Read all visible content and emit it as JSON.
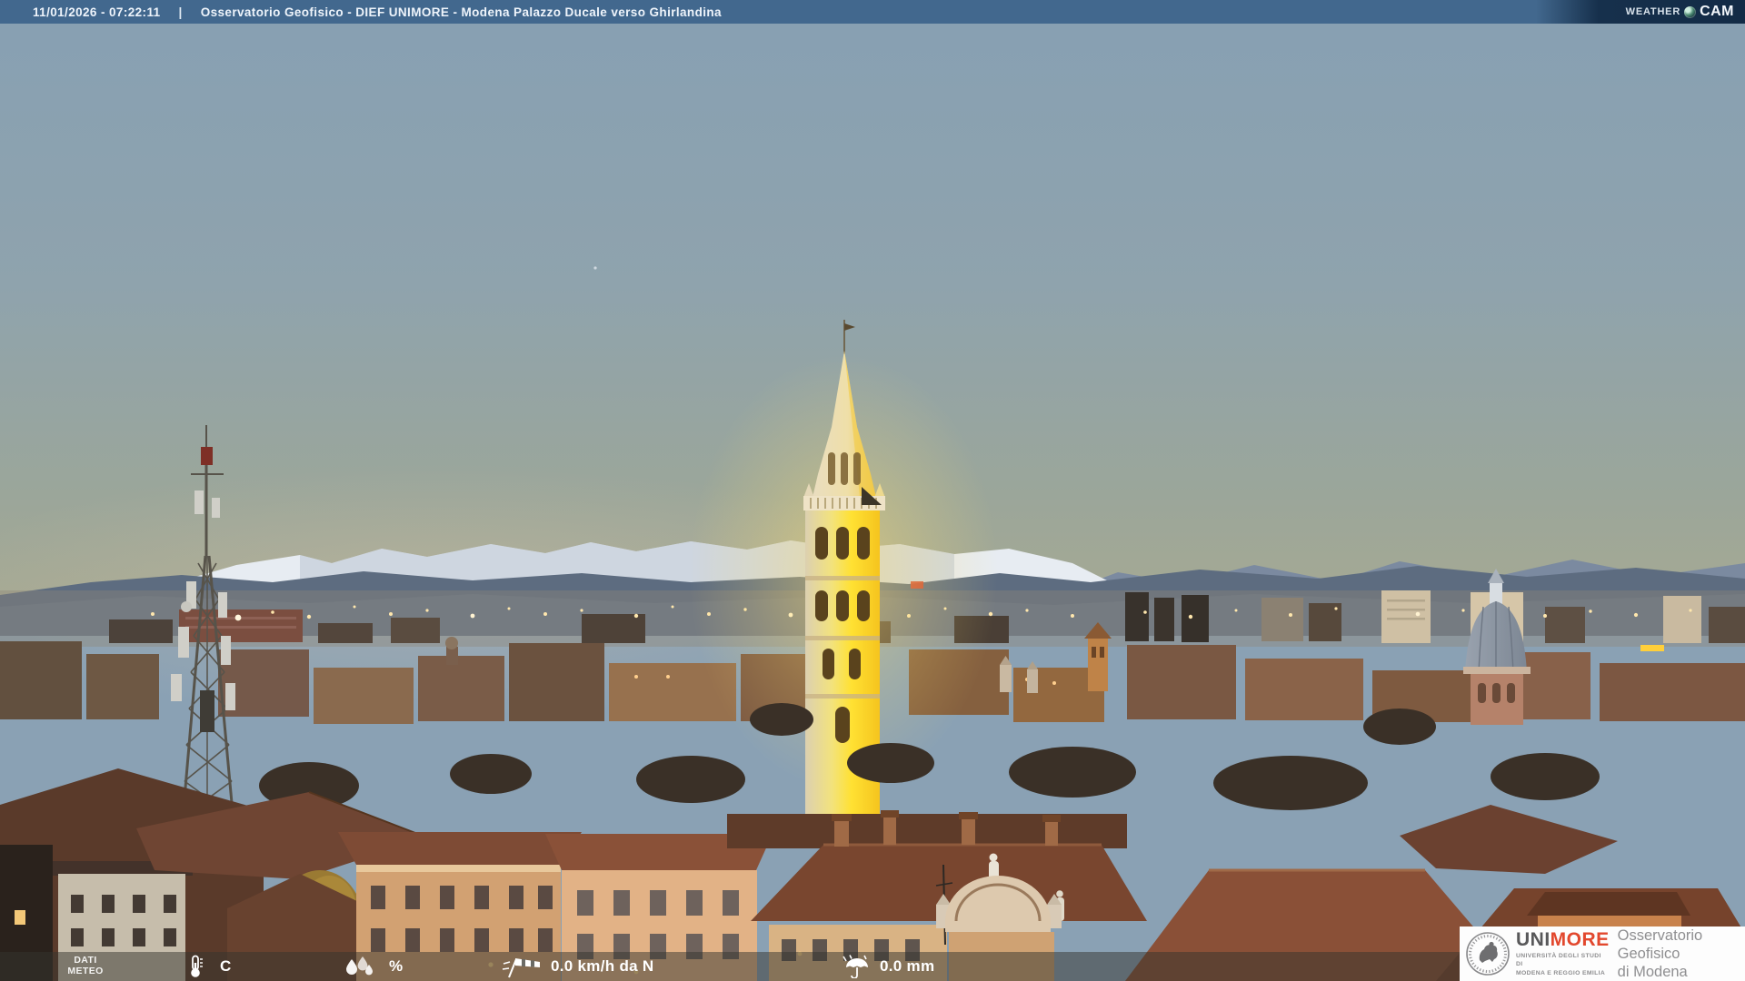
{
  "header": {
    "datetime": "11/01/2026 - 07:22:11",
    "separator": "|",
    "title": "Osservatorio Geofisico - DIEF UNIMORE - Modena Palazzo Ducale verso Ghirlandina",
    "weathercam": {
      "word1": "WEATHER",
      "word2": "CAM",
      "icon": "camera-lens-icon"
    }
  },
  "footer": {
    "dati": {
      "line1": "DATI",
      "line2": "METEO"
    },
    "readings": [
      {
        "id": "temperature",
        "icon": "thermometer-icon",
        "value": "",
        "unit": "C"
      },
      {
        "id": "humidity",
        "icon": "humidity-drops-icon",
        "value": "",
        "unit": "%"
      },
      {
        "id": "wind",
        "icon": "windsock-icon",
        "value": "0.0 km/h da N",
        "unit": ""
      },
      {
        "id": "rain",
        "icon": "umbrella-rain-icon",
        "value": "0.0 mm",
        "unit": ""
      }
    ]
  },
  "branding": {
    "seal_icon": "unimore-seal-icon",
    "acronym_part1": "UNI",
    "acronym_part2": "MORE",
    "university_line1": "UNIVERSITÀ DEGLI STUDI DI",
    "university_line2": "MODENA E REGGIO EMILIA",
    "observatory_line1": "Osservatorio Geofisico",
    "observatory_line2": "di Modena"
  },
  "scene": {
    "subject": "Modena skyline at dawn with illuminated Ghirlandina tower, Apennine mountains on horizon, telecom mast on left, church dome on right",
    "palette": {
      "header_bar": "#42688e",
      "header_logo_bg": "#16304c",
      "sky_top": "#87a0b3",
      "sky_horizon": "#a9aa91",
      "snow_peaks": "#e7ecf2",
      "hills": "#5d6c80",
      "tower_glow": "#ffd52e",
      "roof_terracotta": "#8a5037",
      "footer_overlay": "rgba(52,52,46,0.5)",
      "unimore_red": "#e2482e",
      "unimore_gray": "#8e8e90",
      "beacon_red": "#7e2f26"
    }
  }
}
